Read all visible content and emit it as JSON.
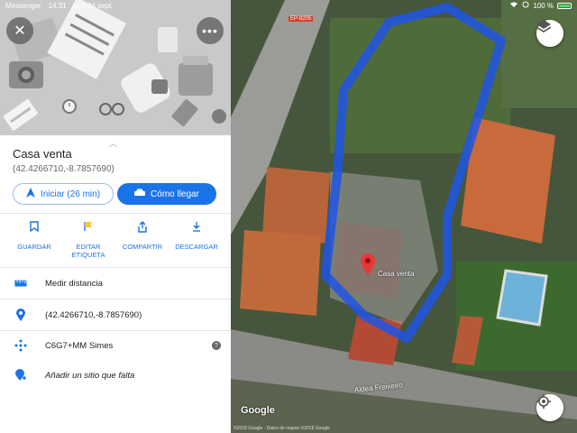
{
  "status_bar": {
    "app": "Messenger",
    "time": "14:31",
    "date": "Lun 24 sept",
    "battery": "100 %"
  },
  "place": {
    "title": "Casa venta",
    "coords": "(42.4266710,-8.7857690)"
  },
  "buttons": {
    "start_label": "Iniciar (26 min)",
    "directions_label": "Cómo llegar"
  },
  "actions": [
    {
      "label": "GUARDAR",
      "icon": "bookmark-icon"
    },
    {
      "label": "EDITAR ETIQUETA",
      "icon": "flag-icon"
    },
    {
      "label": "COMPARTIR",
      "icon": "share-icon"
    },
    {
      "label": "DESCARGAR",
      "icon": "download-icon"
    }
  ],
  "rows": [
    {
      "label": "Medir distancia",
      "icon": "ruler-icon"
    },
    {
      "label": "(42.4266710,-8.7857690)",
      "icon": "location-pin-icon"
    },
    {
      "label": "C6G7+MM Simes",
      "icon": "plus-code-icon"
    },
    {
      "label": "Añadir un sitio que falta",
      "icon": "add-place-icon"
    }
  ],
  "map": {
    "pin_label": "Casa venta",
    "road_label": "Aldea Freixeiro",
    "route_label": "EP-8205",
    "logo": "Google",
    "copyright": "©2018 Google · Datos de mapas ©2018 Google"
  },
  "colors": {
    "accent": "#1a73e8",
    "boundary": "#1f55e6",
    "pin": "#e53935"
  }
}
